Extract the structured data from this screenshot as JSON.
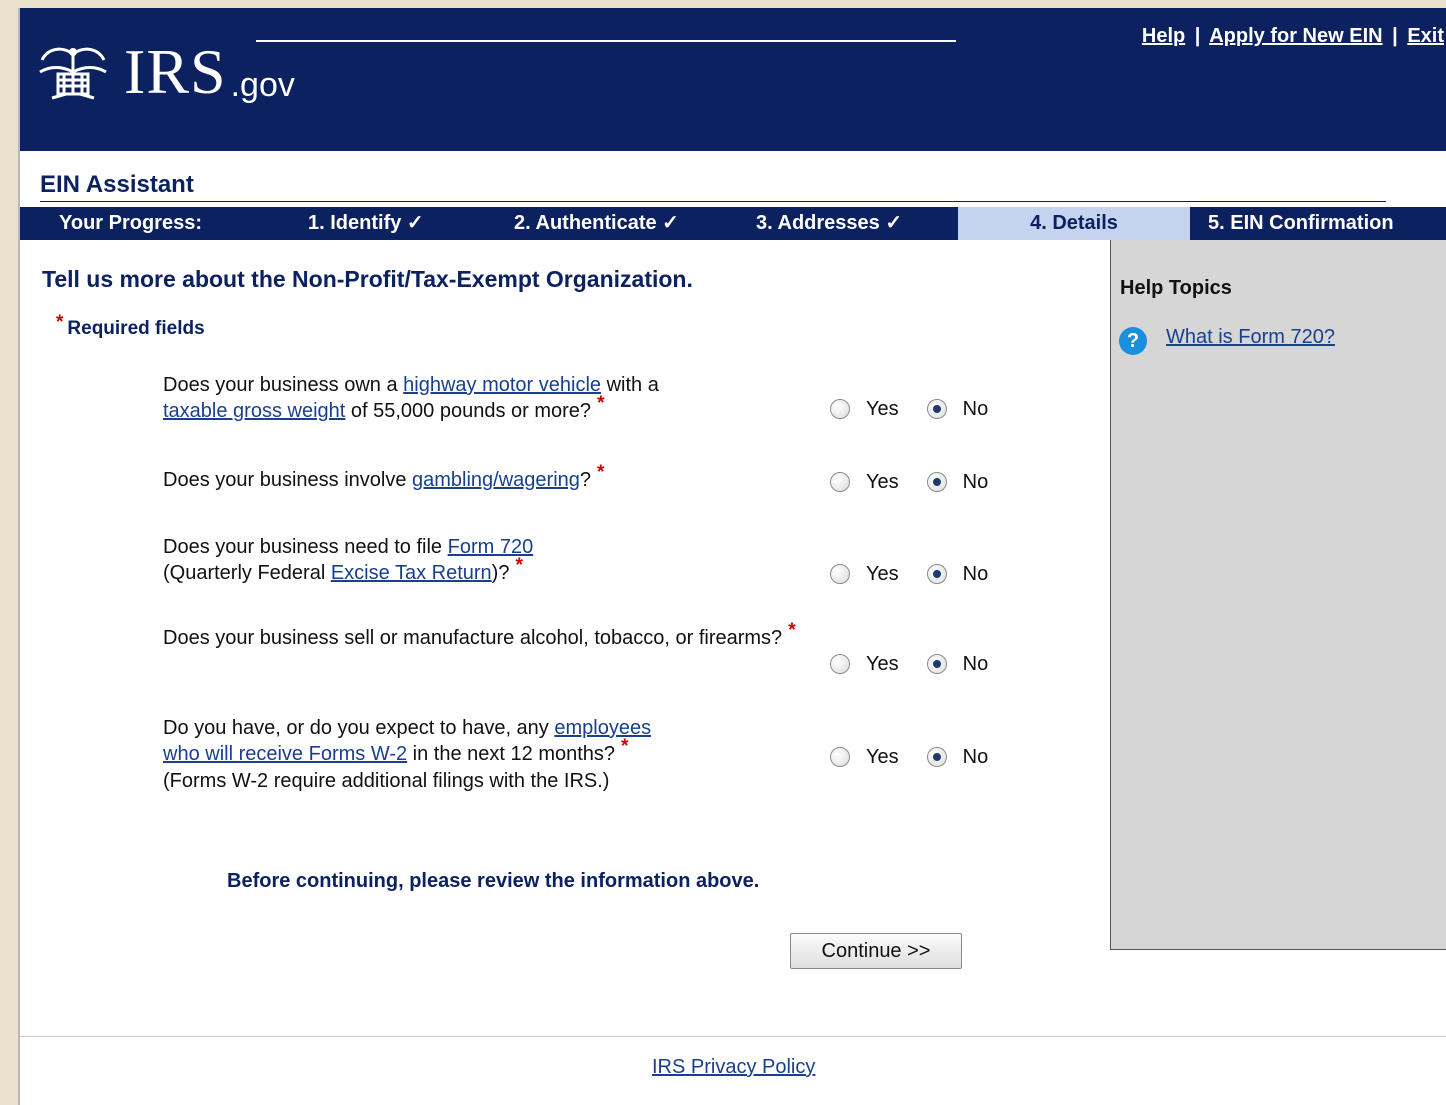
{
  "header": {
    "logo_text": "IRS",
    "logo_suffix": ".gov",
    "links": [
      {
        "label": "Help"
      },
      {
        "label": "Apply for New EIN"
      },
      {
        "label": "Exit"
      }
    ],
    "separator": "|"
  },
  "assistant_title": "EIN Assistant",
  "progress": {
    "label": "Your Progress:",
    "steps": [
      {
        "label": "1. Identify ✓",
        "state": "complete"
      },
      {
        "label": "2. Authenticate ✓",
        "state": "complete"
      },
      {
        "label": "3. Addresses ✓",
        "state": "complete"
      },
      {
        "label": "4. Details",
        "state": "active"
      },
      {
        "label": "5. EIN Confirmation",
        "state": "upcoming"
      }
    ]
  },
  "main": {
    "heading": "Tell us more about the Non-Profit/Tax-Exempt Organization.",
    "required_star": "*",
    "required_label": "Required fields",
    "questions": [
      {
        "t1": "Does your business own a ",
        "link1": "highway motor vehicle",
        "t2": " with a",
        "link2": "taxable gross weight",
        "t3": " of 55,000 pounds or more?",
        "answer": "No"
      },
      {
        "t1": "Does your business involve ",
        "link1": "gambling/wagering",
        "t2": "?",
        "answer": "No"
      },
      {
        "t1": "Does your business need to file ",
        "link1": "Form 720",
        "t2": "(Quarterly Federal ",
        "link2": "Excise Tax Return",
        "t3": ")?",
        "answer": "No"
      },
      {
        "t1": "Does your business sell or manufacture alcohol, tobacco, or firearms?",
        "answer": "No"
      },
      {
        "t1": "Do you have, or do you expect to have, any ",
        "link1": "employees",
        "link2": "who will receive Forms W-2",
        "t2": " in the next 12 months?",
        "t3": "(Forms W-2 require additional filings with the IRS.)",
        "answer": "No"
      }
    ],
    "yes_label": "Yes",
    "no_label": "No",
    "review_message": "Before continuing, please review the information above.",
    "continue_label": "Continue >>"
  },
  "help": {
    "title": "Help Topics",
    "icon_glyph": "?",
    "icon": "question-circle-icon",
    "link": "What is Form 720?"
  },
  "footer": {
    "privacy_link": "IRS Privacy Policy"
  },
  "colors": {
    "brand_navy": "#0c2160",
    "active_step": "#c5d3ef",
    "link": "#1a3f8f",
    "required_star": "#cc0000",
    "help_panel": "#d6d6d6"
  }
}
